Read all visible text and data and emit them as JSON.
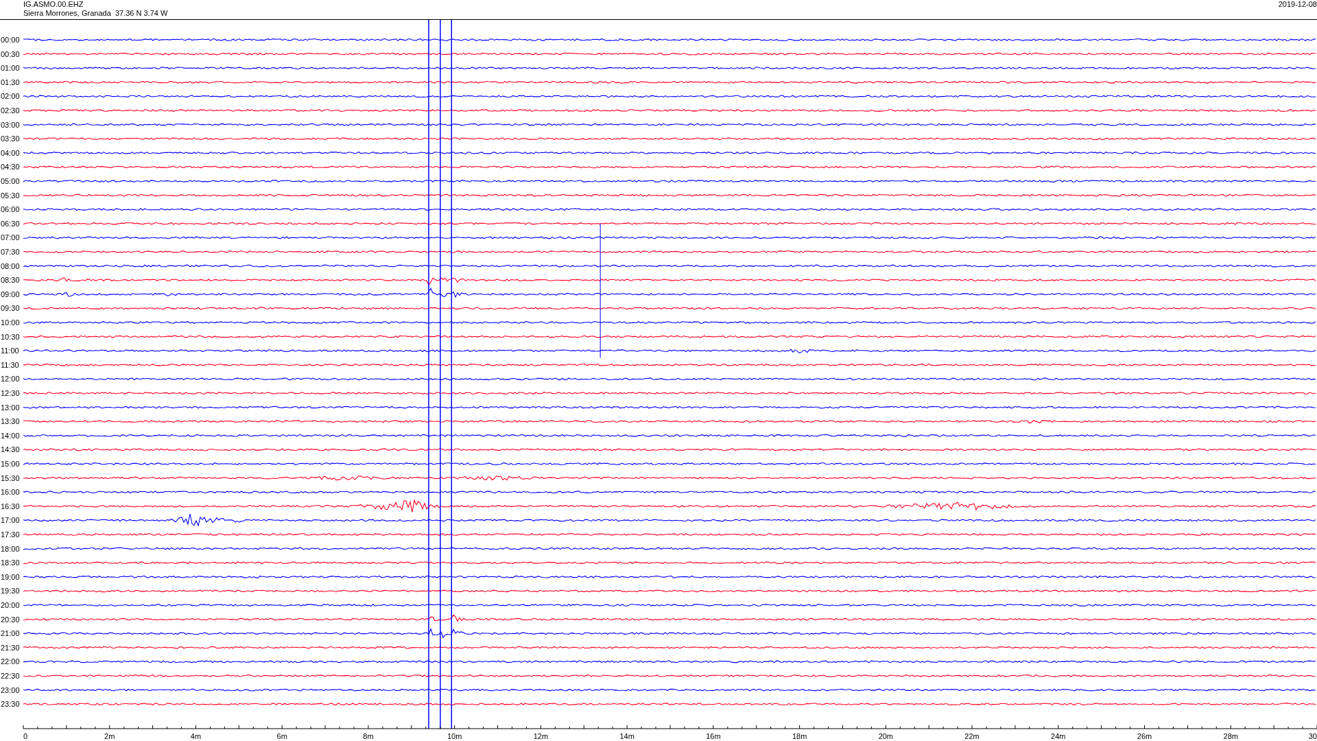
{
  "header": {
    "station": "IG.ASMO.00.EHZ",
    "location": "Sierra Morrones, Granada  37.36 N 3.74 W",
    "date": "2019-12-08"
  },
  "traces": [
    {
      "time": "00:00",
      "color": "#0000ff"
    },
    {
      "time": "00:30",
      "color": "#ff0022"
    },
    {
      "time": "01:00",
      "color": "#0000ff"
    },
    {
      "time": "01:30",
      "color": "#ff0022"
    },
    {
      "time": "02:00",
      "color": "#0000ff"
    },
    {
      "time": "02:30",
      "color": "#ff0022"
    },
    {
      "time": "03:00",
      "color": "#0000ff"
    },
    {
      "time": "03:30",
      "color": "#ff0022"
    },
    {
      "time": "04:00",
      "color": "#0000ff"
    },
    {
      "time": "04:30",
      "color": "#ff0022"
    },
    {
      "time": "05:00",
      "color": "#0000ff"
    },
    {
      "time": "05:30",
      "color": "#ff0022"
    },
    {
      "time": "06:00",
      "color": "#0000ff"
    },
    {
      "time": "06:30",
      "color": "#ff0022"
    },
    {
      "time": "07:00",
      "color": "#0000ff"
    },
    {
      "time": "07:30",
      "color": "#ff0022"
    },
    {
      "time": "08:00",
      "color": "#0000ff"
    },
    {
      "time": "08:30",
      "color": "#ff0022"
    },
    {
      "time": "09:00",
      "color": "#0000ff"
    },
    {
      "time": "09:30",
      "color": "#ff0022"
    },
    {
      "time": "10:00",
      "color": "#0000ff"
    },
    {
      "time": "10:30",
      "color": "#ff0022"
    },
    {
      "time": "11:00",
      "color": "#0000ff"
    },
    {
      "time": "11:30",
      "color": "#ff0022"
    },
    {
      "time": "12:00",
      "color": "#0000ff"
    },
    {
      "time": "12:30",
      "color": "#ff0022"
    },
    {
      "time": "13:00",
      "color": "#0000ff"
    },
    {
      "time": "13:30",
      "color": "#ff0022"
    },
    {
      "time": "14:00",
      "color": "#0000ff"
    },
    {
      "time": "14:30",
      "color": "#ff0022"
    },
    {
      "time": "15:00",
      "color": "#0000ff"
    },
    {
      "time": "15:30",
      "color": "#ff0022"
    },
    {
      "time": "16:00",
      "color": "#0000ff"
    },
    {
      "time": "16:30",
      "color": "#ff0022"
    },
    {
      "time": "17:00",
      "color": "#0000ff"
    },
    {
      "time": "17:30",
      "color": "#ff0022"
    },
    {
      "time": "18:00",
      "color": "#0000ff"
    },
    {
      "time": "18:30",
      "color": "#ff0022"
    },
    {
      "time": "19:00",
      "color": "#0000ff"
    },
    {
      "time": "19:30",
      "color": "#ff0022"
    },
    {
      "time": "20:00",
      "color": "#0000ff"
    },
    {
      "time": "20:30",
      "color": "#ff0022"
    },
    {
      "time": "21:00",
      "color": "#0000ff"
    },
    {
      "time": "21:30",
      "color": "#ff0022"
    },
    {
      "time": "22:00",
      "color": "#0000ff"
    },
    {
      "time": "22:30",
      "color": "#ff0022"
    },
    {
      "time": "23:00",
      "color": "#0000ff"
    },
    {
      "time": "23:30",
      "color": "#ff0022"
    }
  ],
  "x_axis": {
    "labels": [
      "0",
      "2m",
      "4m",
      "6m",
      "8m",
      "10m",
      "12m",
      "14m",
      "16m",
      "18m",
      "20m",
      "22m",
      "24m",
      "26m",
      "28m",
      "30"
    ]
  }
}
